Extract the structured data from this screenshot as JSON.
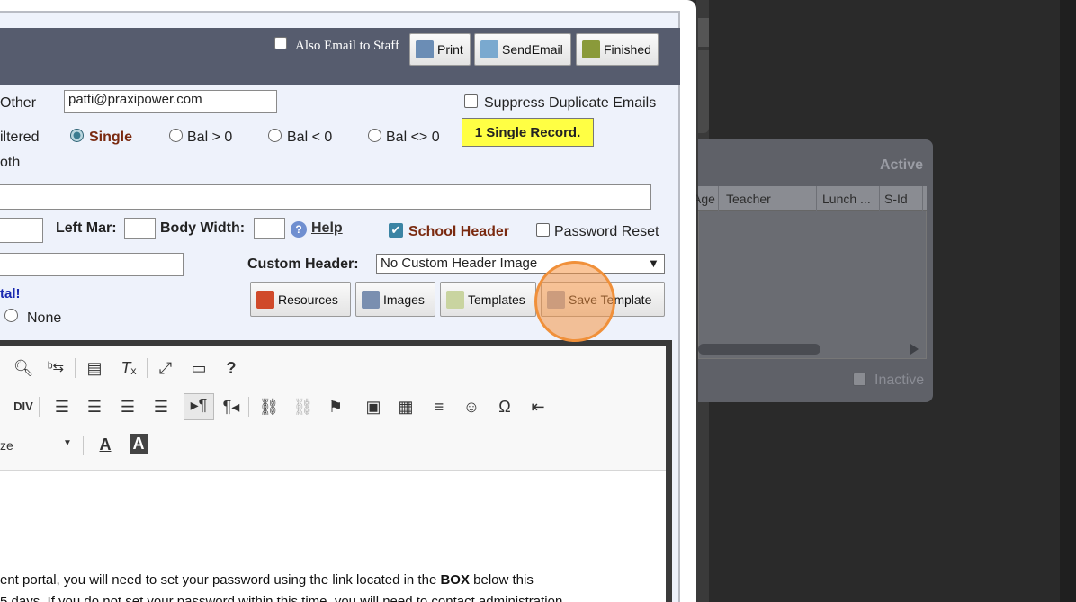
{
  "header": {
    "also_email_staff_label": "Also Email to Staff",
    "buttons": {
      "print": "Print",
      "send_email": "SendEmail",
      "finished": "Finished"
    }
  },
  "email": {
    "other_label": "Other",
    "other_value": "patti@praxipower.com",
    "suppress_duplicates_label": "Suppress Duplicate Emails"
  },
  "filters": {
    "filtered_label": "iltered",
    "both_label": "oth",
    "options": [
      "Single",
      "Bal > 0",
      "Bal < 0",
      "Bal <> 0"
    ],
    "selected": "Single",
    "record_badge": "1 Single Record."
  },
  "layout": {
    "left_mar_label": "Left Mar:",
    "body_width_label": "Body Width:",
    "help_label": "Help",
    "school_header_label": "School Header",
    "school_header_checked": true,
    "password_reset_label": "Password Reset",
    "custom_header_label": "Custom Header:",
    "custom_header_value": "No Custom Header Image",
    "portal_label": "tal!",
    "none_label": "None"
  },
  "actions": {
    "resources": "Resources",
    "images": "Images",
    "templates": "Templates",
    "save_template": "Save Template"
  },
  "editor": {
    "size_label": "ze",
    "body_line1_pre": "ent portal, you will need to set your password using the link located in the ",
    "body_line1_bold": "BOX",
    "body_line1_post": " below this",
    "body_line2": "5 days.  If you do not set your password within this time, you will need to contact administration."
  },
  "background": {
    "panel_title": "Active",
    "columns": [
      "Age",
      "Teacher",
      "Lunch ...",
      "S-Id"
    ],
    "inactive_label": "Inactive"
  },
  "colors": {
    "topbar": "#565c6e",
    "badge": "#ffff44",
    "school_header_text": "#7a2a10",
    "highlight": "#f0903a"
  }
}
